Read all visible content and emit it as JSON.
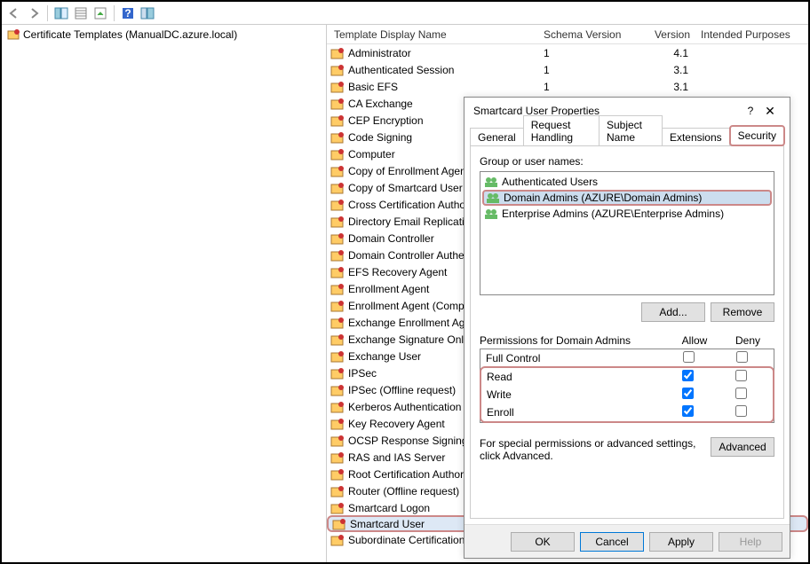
{
  "tree": {
    "root_label": "Certificate Templates (ManualDC.azure.local)"
  },
  "columns": {
    "c1": "Template Display Name",
    "c2": "Schema Version",
    "c3": "Version",
    "c4": "Intended Purposes"
  },
  "templates": [
    {
      "name": "Administrator",
      "sv": "1",
      "v": "4.1"
    },
    {
      "name": "Authenticated Session",
      "sv": "1",
      "v": "3.1"
    },
    {
      "name": "Basic EFS",
      "sv": "1",
      "v": "3.1"
    },
    {
      "name": "CA Exchange"
    },
    {
      "name": "CEP Encryption"
    },
    {
      "name": "Code Signing"
    },
    {
      "name": "Computer"
    },
    {
      "name": "Copy of Enrollment Agent"
    },
    {
      "name": "Copy of Smartcard User"
    },
    {
      "name": "Cross Certification Authority"
    },
    {
      "name": "Directory Email Replication"
    },
    {
      "name": "Domain Controller"
    },
    {
      "name": "Domain Controller Authentication"
    },
    {
      "name": "EFS Recovery Agent"
    },
    {
      "name": "Enrollment Agent"
    },
    {
      "name": "Enrollment Agent (Computer)"
    },
    {
      "name": "Exchange Enrollment Agent"
    },
    {
      "name": "Exchange Signature Only"
    },
    {
      "name": "Exchange User"
    },
    {
      "name": "IPSec"
    },
    {
      "name": "IPSec (Offline request)"
    },
    {
      "name": "Kerberos Authentication"
    },
    {
      "name": "Key Recovery Agent"
    },
    {
      "name": "OCSP Response Signing"
    },
    {
      "name": "RAS and IAS Server"
    },
    {
      "name": "Root Certification Authority"
    },
    {
      "name": "Router (Offline request)"
    },
    {
      "name": "Smartcard Logon"
    },
    {
      "name": "Smartcard User",
      "selected": true,
      "highlighted": true
    },
    {
      "name": "Subordinate Certification Authority"
    }
  ],
  "dialog": {
    "title": "Smartcard User Properties",
    "tabs": [
      "General",
      "Request Handling",
      "Subject Name",
      "Extensions",
      "Security"
    ],
    "active_tab": 4,
    "group_label": "Group or user names:",
    "groups": [
      {
        "name": "Authenticated Users"
      },
      {
        "name": "Domain Admins (AZURE\\Domain Admins)",
        "selected": true,
        "highlighted": true
      },
      {
        "name": "Enterprise Admins (AZURE\\Enterprise Admins)"
      }
    ],
    "add_btn": "Add...",
    "remove_btn": "Remove",
    "perm_label": "Permissions for Domain Admins",
    "allow": "Allow",
    "deny": "Deny",
    "perms": [
      {
        "name": "Full Control",
        "allow": false,
        "deny": false
      },
      {
        "name": "Read",
        "allow": true,
        "deny": false,
        "hl": true
      },
      {
        "name": "Write",
        "allow": true,
        "deny": false,
        "hl": true
      },
      {
        "name": "Enroll",
        "allow": true,
        "deny": false,
        "hl": true
      }
    ],
    "special_text": "For special permissions or advanced settings, click Advanced.",
    "advanced_btn": "Advanced",
    "ok": "OK",
    "cancel": "Cancel",
    "apply": "Apply",
    "help": "Help"
  }
}
